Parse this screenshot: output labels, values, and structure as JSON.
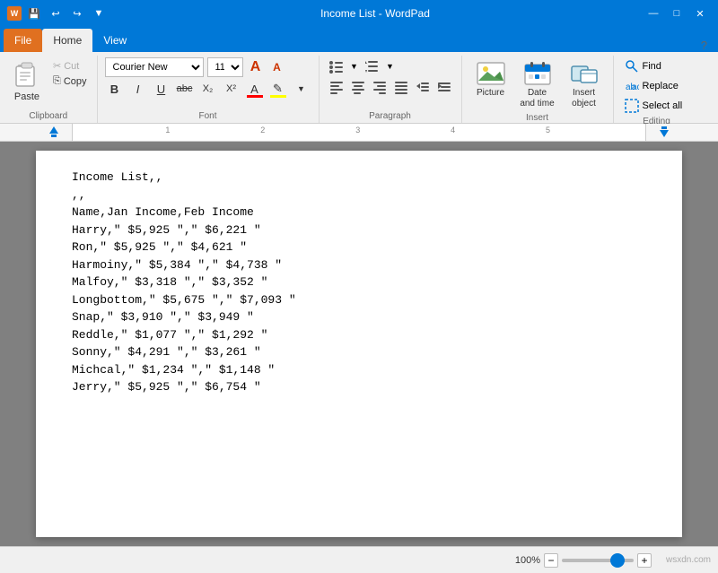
{
  "titleBar": {
    "title": "Income List - WordPad",
    "minimize": "—",
    "maximize": "□",
    "close": "✕",
    "qat": [
      "💾",
      "↩",
      "↪",
      "▼"
    ]
  },
  "ribbonTabs": {
    "file": "File",
    "home": "Home",
    "view": "View"
  },
  "clipboard": {
    "paste": "Paste",
    "cut": "Cut",
    "copy": "Copy",
    "label": "Clipboard"
  },
  "font": {
    "name": "Courier New",
    "size": "11",
    "bold": "B",
    "italic": "I",
    "underline": "U",
    "strikethrough": "abc",
    "subscript": "X₂",
    "superscript": "X²",
    "fontColor": "A",
    "highlight": "✎",
    "label": "Font"
  },
  "paragraph": {
    "label": "Paragraph"
  },
  "insert": {
    "picture": "Picture",
    "datetime": "Date and time",
    "object": "Insert object",
    "label": "Insert"
  },
  "editing": {
    "find": "Find",
    "replace": "Replace",
    "selectAll": "Select all",
    "label": "Editing"
  },
  "document": {
    "content": "Income List,,\n,,\nName,Jan Income,Feb Income\nHarry,\" $5,925 \",\" $6,221 \"\nRon,\" $5,925 \",\" $4,621 \"\nHarmoiny,\" $5,384 \",\" $4,738 \"\nMalfoy,\" $3,318 \",\" $3,352 \"\nLongbottom,\" $5,675 \",\" $7,093 \"\nSnap,\" $3,910 \",\" $3,949 \"\nReddle,\" $1,077 \",\" $1,292 \"\nSonny,\" $4,291 \",\" $3,261 \"\nMichcal,\" $1,234 \",\" $1,148 \"\nJerry,\" $5,925 \",\" $6,754 \""
  },
  "statusBar": {
    "zoom": "100%",
    "watermark": "wsxdn.com"
  }
}
